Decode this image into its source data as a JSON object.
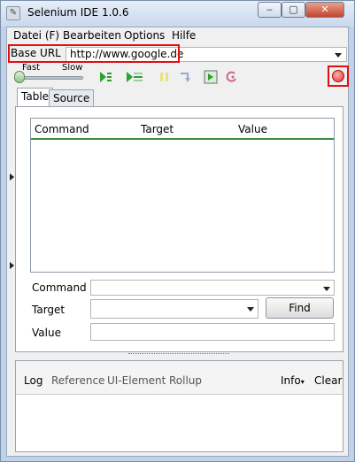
{
  "window": {
    "title": "Selenium IDE 1.0.6",
    "controls": [
      "minimize",
      "maximize",
      "close"
    ]
  },
  "menu": {
    "items": [
      {
        "label": "Datei (F)"
      },
      {
        "label": "Bearbeiten"
      },
      {
        "label": "Options"
      },
      {
        "label": "Hilfe"
      }
    ]
  },
  "base_url": {
    "label": "Base URL",
    "value": "http://www.google.de"
  },
  "toolbar": {
    "speed_fast": "Fast",
    "speed_slow": "Slow",
    "speed_level": 0.0,
    "icons": [
      "play-all-icon",
      "play-current-icon",
      "pause-icon",
      "step-icon",
      "test-runner-icon",
      "rollup-icon",
      "record-icon"
    ],
    "record_color": "#e42f2f"
  },
  "tabs": [
    {
      "label": "Table",
      "active": true
    },
    {
      "label": "Source",
      "active": false
    }
  ],
  "table": {
    "columns": [
      "Command",
      "Target",
      "Value"
    ],
    "rows": []
  },
  "editor": {
    "command_label": "Command",
    "target_label": "Target",
    "value_label": "Value",
    "find_label": "Find",
    "command_value": "",
    "target_value": "",
    "value_value": ""
  },
  "log": {
    "tabs": [
      "Log",
      "Reference",
      "UI-Element",
      "Rollup"
    ],
    "info_label": "Info",
    "clear_label": "Clear"
  },
  "colors": {
    "highlight": "#e01010",
    "header_rule": "#3d8a3d"
  }
}
